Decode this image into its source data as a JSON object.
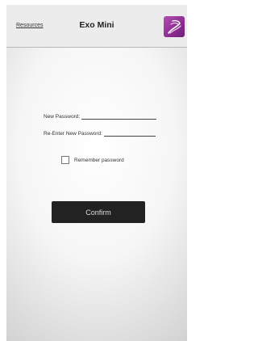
{
  "header": {
    "resources_label": "Resources",
    "title": "Exo Mini",
    "logo_icon": "exo-swirl-logo",
    "logo_color": "#9b3fa0"
  },
  "form": {
    "new_password_label": "New Password:",
    "new_password_value": "",
    "reenter_password_label": "Re-Enter New Password:",
    "reenter_password_value": "",
    "remember_label": "Remember password",
    "remember_checked": false,
    "confirm_label": "Confirm"
  }
}
